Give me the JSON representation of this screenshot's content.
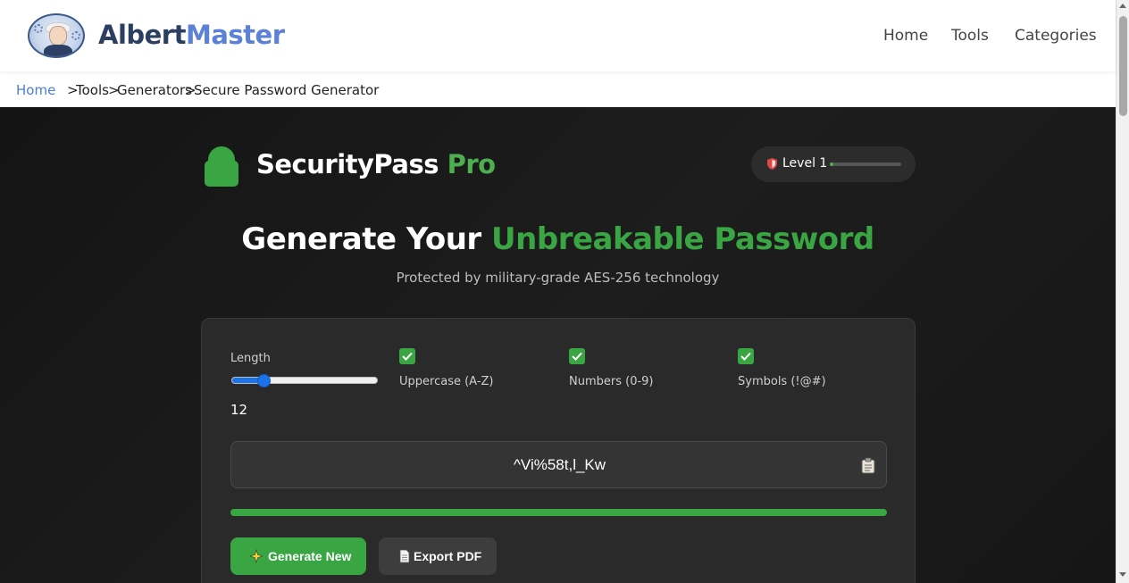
{
  "header": {
    "brand_part1": "Albert",
    "brand_part2": "Master",
    "nav": [
      "Home",
      "Tools",
      "Categories"
    ]
  },
  "breadcrumb": {
    "home": "Home",
    "sep": ">",
    "items": [
      "Tools",
      "Generators",
      "Secure Password Generator"
    ]
  },
  "app": {
    "title": "SecurityPass",
    "title_suffix": "Pro",
    "level_label": "Level 1",
    "level_progress": 0.05
  },
  "hero": {
    "headline_part1": "Generate Your",
    "headline_part2": "Unbreakable Password",
    "subline": "Protected by military-grade AES-256 technology"
  },
  "options": {
    "length_label": "Length",
    "length_value": "12",
    "length_min": 8,
    "length_max": 64,
    "uppercase_label": "Uppercase (A-Z)",
    "numbers_label": "Numbers (0-9)",
    "symbols_label": "Symbols (!@#)",
    "uppercase_checked": true,
    "numbers_checked": true,
    "symbols_checked": true
  },
  "password": {
    "value": "^Vi%58t,l_Kw",
    "strength": 1.0
  },
  "actions": {
    "generate_label": "Generate New",
    "export_label": "Export PDF"
  },
  "colors": {
    "accent_green": "#3aa543",
    "brand_blue": "#5b82d6",
    "brand_navy": "#2d3e63"
  }
}
